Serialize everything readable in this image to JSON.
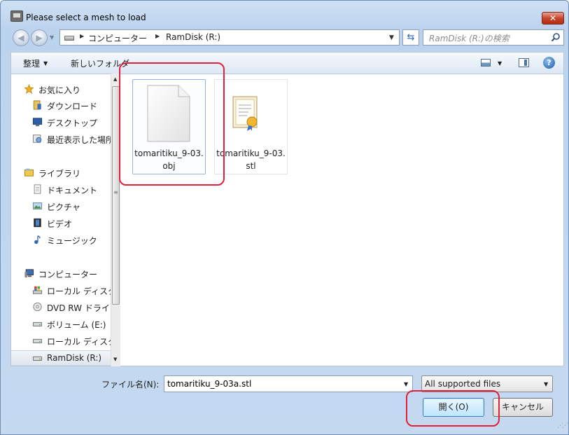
{
  "window": {
    "title": "Please select a mesh to load",
    "close_glyph": "✕"
  },
  "address": {
    "crumbs": [
      "コンピューター",
      "RamDisk (R:)"
    ],
    "search_placeholder": "RamDisk (R:)の検索"
  },
  "toolbar": {
    "organize": "整理",
    "new_folder": "新しいフォルダー",
    "help": "?"
  },
  "nav": {
    "items": [
      {
        "label": "お気に入り",
        "icon": "star-icon",
        "group": true
      },
      {
        "label": "ダウンロード",
        "icon": "downloads-icon",
        "group": false
      },
      {
        "label": "デスクトップ",
        "icon": "desktop-icon",
        "group": false
      },
      {
        "label": "最近表示した場所",
        "icon": "recent-places-icon",
        "group": false
      },
      {
        "label": "ライブラリ",
        "icon": "library-icon",
        "group": true
      },
      {
        "label": "ドキュメント",
        "icon": "documents-icon",
        "group": false
      },
      {
        "label": "ピクチャ",
        "icon": "pictures-icon",
        "group": false
      },
      {
        "label": "ビデオ",
        "icon": "videos-icon",
        "group": false
      },
      {
        "label": "ミュージック",
        "icon": "music-icon",
        "group": false
      },
      {
        "label": "コンピューター",
        "icon": "computer-icon",
        "group": true
      },
      {
        "label": "ローカル ディスク",
        "icon": "local-disk-icon",
        "group": false
      },
      {
        "label": "DVD RW ドライブ",
        "icon": "dvd-drive-icon",
        "group": false
      },
      {
        "label": "ボリューム (E:)",
        "icon": "drive-icon",
        "group": false
      },
      {
        "label": "ローカル ディスク",
        "icon": "drive-icon",
        "group": false
      },
      {
        "label": "RamDisk (R:)",
        "icon": "drive-icon",
        "group": false,
        "selected": true
      }
    ]
  },
  "files": [
    {
      "name": "tomaritiku_9-03.obj",
      "icon": "document-icon",
      "selected": true
    },
    {
      "name": "tomaritiku_9-03.stl",
      "icon": "certificate-icon",
      "selected": false
    }
  ],
  "bottom": {
    "filename_label": "ファイル名(N):",
    "filename_value": "tomaritiku_9-03a.stl",
    "filetype_value": "All supported files",
    "open_label": "開く(O)",
    "cancel_label": "キャンセル"
  },
  "colors": {
    "annotation": "#e3203a",
    "selection_border": "#8fb6e3"
  }
}
